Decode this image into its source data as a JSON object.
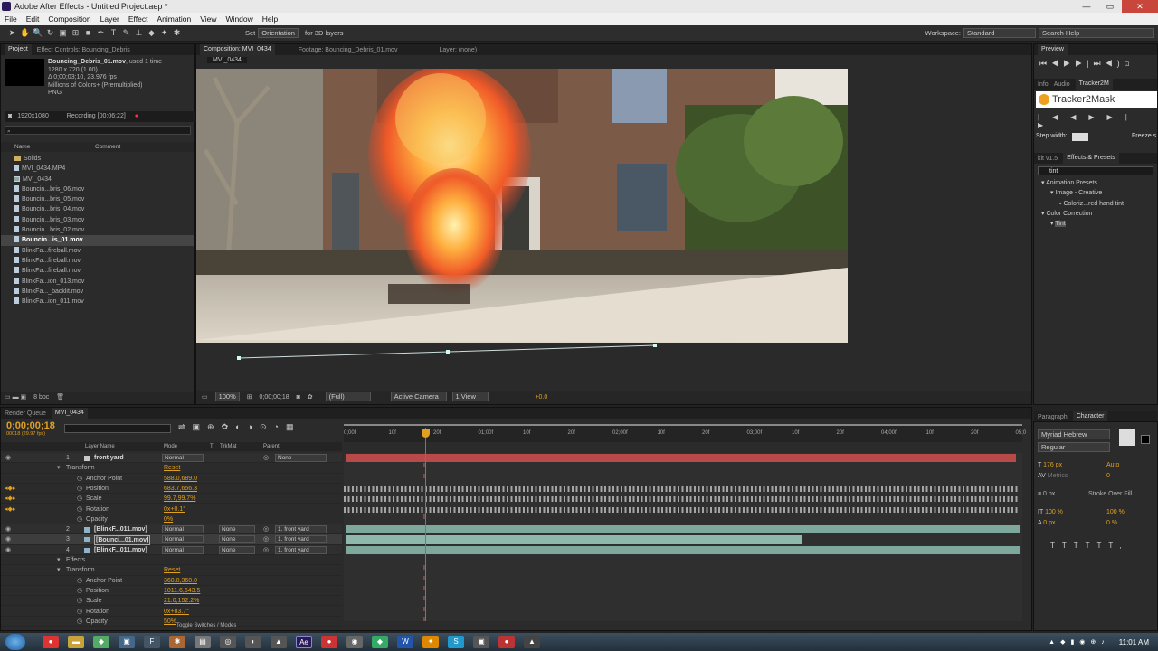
{
  "window": {
    "title": "Adobe After Effects - Untitled Project.aep *"
  },
  "menu": [
    "File",
    "Edit",
    "Composition",
    "Layer",
    "Effect",
    "Animation",
    "View",
    "Window",
    "Help"
  ],
  "toolbar": {
    "set": "Set",
    "orientation": "Orientation",
    "for3d": "for 3D layers",
    "workspace_label": "Workspace:",
    "workspace_value": "Standard",
    "search_placeholder": "Search Help"
  },
  "project": {
    "tab": "Project",
    "effect_controls_tab": "Effect Controls: Bouncing_Debris",
    "item_name": "Bouncing_Debris_01.mov",
    "item_used": ", used 1 time",
    "info_lines": [
      "1280 x 720 (1.00)",
      "Δ 0;00;03;10, 23.976 fps",
      "Millions of Colors+ (Premultiplied)",
      "PNG"
    ],
    "resolution": "1920x1080",
    "recording": "Recording [00:06:22]",
    "col_name": "Name",
    "col_comment": "Comment",
    "items": [
      {
        "label": "Solids",
        "type": "folder"
      },
      {
        "label": "MVI_0434.MP4",
        "type": "file"
      },
      {
        "label": "MVI_0434",
        "type": "comp"
      },
      {
        "label": "Bouncin...bris_06.mov",
        "type": "file"
      },
      {
        "label": "Bouncin...bris_05.mov",
        "type": "file"
      },
      {
        "label": "Bouncin...bris_04.mov",
        "type": "file"
      },
      {
        "label": "Bouncin...bris_03.mov",
        "type": "file"
      },
      {
        "label": "Bouncin...bris_02.mov",
        "type": "file"
      },
      {
        "label": "Bouncin...is_01.mov",
        "type": "file",
        "selected": true
      },
      {
        "label": "BlinkFa...fireball.mov",
        "type": "file"
      },
      {
        "label": "BlinkFa...fireball.mov",
        "type": "file"
      },
      {
        "label": "BlinkFa...fireball.mov",
        "type": "file"
      },
      {
        "label": "BlinkFa...ion_013.mov",
        "type": "file"
      },
      {
        "label": "BlinkFa..._backlit.mov",
        "type": "file"
      },
      {
        "label": "BlinkFa...ion_011.mov",
        "type": "file"
      }
    ],
    "bpc": "8 bpc"
  },
  "comp": {
    "tab": "Composition: MVI_0434",
    "footage_tab": "Footage: Bouncing_Debris_01.mov",
    "layer_tab": "Layer: (none)",
    "breadcrumb": "MVI_0434",
    "zoom": "100%",
    "timecode": "0;00;00;18",
    "quality": "(Full)",
    "camera": "Active Camera",
    "views": "1 View",
    "exposure": "+0.0"
  },
  "right": {
    "preview_tab": "Preview",
    "info_tab": "Info",
    "audio_tab": "Audio",
    "tracker_tab": "Tracker2M",
    "tracker_title": "Tracker2Mask",
    "step_width": "Step width:",
    "freeze": "Freeze s",
    "kit_tab": "kit v1.5",
    "effects_tab": "Effects & Presets",
    "search_value": "tint",
    "tree": [
      {
        "label": "Animation Presets",
        "indent": 0
      },
      {
        "label": "Image - Creative",
        "indent": 1
      },
      {
        "label": "Coloriz...red hand tint",
        "indent": 2
      },
      {
        "label": "Color Correction",
        "indent": 0
      },
      {
        "label": "Tint",
        "indent": 1
      }
    ],
    "paragraph_tab": "Paragraph",
    "character_tab": "Character",
    "font": "Myriad Hebrew",
    "style": "Regular",
    "size": "176 px",
    "leading": "Auto",
    "kerning": "Metrics",
    "tracking": "0",
    "stroke": "0 px",
    "stroke_type": "Stroke Over Fill",
    "vscale": "100 %",
    "hscale": "100 %",
    "baseline": "0 px",
    "tsume": "0 %"
  },
  "timeline": {
    "render_tab": "Render Queue",
    "comp_tab": "MVI_0434",
    "time": "0;00;00;18",
    "fps": "00018 (29.97 fps)",
    "headers": {
      "layer_name": "Layer Name",
      "mode": "Mode",
      "t": "T",
      "trkmat": "TrkMat",
      "parent": "Parent"
    },
    "ruler": [
      "0;00f",
      "10f",
      "20f",
      "01;00f",
      "10f",
      "20f",
      "02;00f",
      "10f",
      "20f",
      "03;00f",
      "10f",
      "20f",
      "04;00f",
      "10f",
      "20f",
      "05;0"
    ],
    "rows": [
      {
        "kind": "layer",
        "num": "1",
        "name": "front yard",
        "mode": "Normal",
        "parent": "None",
        "color": "#c8c8c8"
      },
      {
        "kind": "group",
        "name": "Transform",
        "value": "Reset"
      },
      {
        "kind": "prop",
        "name": "Anchor Point",
        "value": "588.0,689.0"
      },
      {
        "kind": "prop",
        "name": "Position",
        "value": "683.7,656.3",
        "keys": true
      },
      {
        "kind": "prop",
        "name": "Scale",
        "value": "99.7,99.7%",
        "keys": true
      },
      {
        "kind": "prop",
        "name": "Rotation",
        "value": "0x+0.1°",
        "keys": true
      },
      {
        "kind": "prop",
        "name": "Opacity",
        "value": "0%"
      },
      {
        "kind": "layer",
        "num": "2",
        "name": "[BlinkF...011.mov]",
        "mode": "Normal",
        "trkmat": "None",
        "parent": "1. front yard",
        "color": "#8fb3c9"
      },
      {
        "kind": "layer",
        "num": "3",
        "name": "[Bounci...01.mov]",
        "mode": "Normal",
        "trkmat": "None",
        "parent": "1. front yard",
        "color": "#8fb3c9",
        "selected": true
      },
      {
        "kind": "layer",
        "num": "4",
        "name": "[BlinkF...011.mov]",
        "mode": "Normal",
        "trkmat": "None",
        "parent": "1. front yard",
        "color": "#8fb3c9"
      },
      {
        "kind": "group",
        "name": "Effects",
        "value": ""
      },
      {
        "kind": "group",
        "name": "Transform",
        "value": "Reset"
      },
      {
        "kind": "prop",
        "name": "Anchor Point",
        "value": "360.0,360.0"
      },
      {
        "kind": "prop",
        "name": "Position",
        "value": "1011.6,643.5"
      },
      {
        "kind": "prop",
        "name": "Scale",
        "value": "21.0,152.2%"
      },
      {
        "kind": "prop",
        "name": "Rotation",
        "value": "0x+83.7°"
      },
      {
        "kind": "prop",
        "name": "Opacity",
        "value": "50%"
      }
    ],
    "toggle": "Toggle Switches / Modes"
  },
  "taskbar": {
    "time": "11:01 AM"
  }
}
